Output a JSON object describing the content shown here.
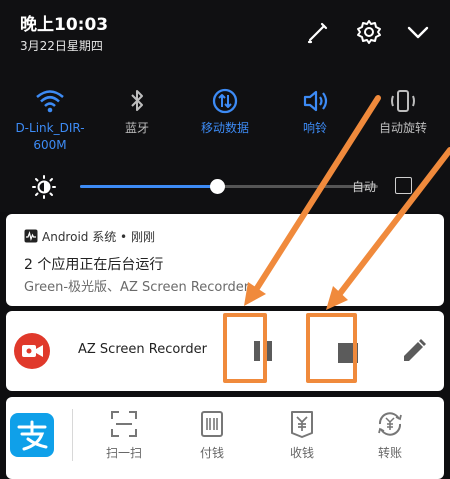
{
  "status": {
    "time": "晚上10:03",
    "date": "3月22日星期四"
  },
  "header_icons": [
    "edit-icon",
    "gear-icon",
    "chevron-down-icon"
  ],
  "quick_settings": [
    {
      "name": "wifi",
      "label": "D-Link_DIR-600M",
      "label_line1": "D-Link_DIR-",
      "label_line2": "600M",
      "active": true,
      "icon": "wifi-icon"
    },
    {
      "name": "bluetooth",
      "label": "蓝牙",
      "active": false,
      "icon": "bluetooth-icon"
    },
    {
      "name": "mobile-data",
      "label": "移动数据",
      "active": true,
      "icon": "mobile-data-icon"
    },
    {
      "name": "sound",
      "label": "响铃",
      "active": true,
      "icon": "speaker-icon"
    },
    {
      "name": "auto-rotate",
      "label": "自动旋转",
      "active": false,
      "icon": "rotate-icon"
    }
  ],
  "brightness": {
    "level": 0.46,
    "auto_label": "自动",
    "auto_checked": false
  },
  "android_notification": {
    "app": "Android 系统",
    "separator": " • ",
    "time": "刚刚",
    "title": "2 个应用正在后台运行",
    "body": "Green-极光版、AZ Screen Recorder"
  },
  "az_notification": {
    "app_name": "AZ Screen Recorder",
    "actions": [
      "pause-icon",
      "stop-icon",
      "pencil-icon"
    ]
  },
  "alipay": {
    "items": [
      {
        "label": "扫一扫",
        "icon": "scan-icon"
      },
      {
        "label": "付钱",
        "icon": "barcode-icon"
      },
      {
        "label": "收钱",
        "icon": "yuan-receive-icon"
      },
      {
        "label": "转账",
        "icon": "yuan-transfer-icon"
      }
    ]
  },
  "colors": {
    "accent": "#3d8bf5",
    "highlight": "#f08a3c",
    "alipay_blue": "#0fa0e9",
    "az_red": "#e0392b"
  }
}
